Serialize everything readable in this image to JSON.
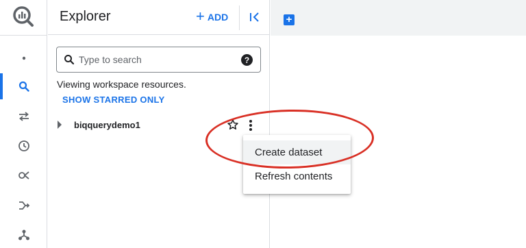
{
  "explorer": {
    "title": "Explorer",
    "add_label": "ADD",
    "search": {
      "placeholder": "Type to search",
      "value": ""
    },
    "help_glyph": "?",
    "viewing_text": "Viewing workspace resources.",
    "show_starred_label": "SHOW STARRED ONLY",
    "projects": [
      {
        "name": "biqquerydemo1"
      }
    ]
  },
  "context_menu": {
    "items": [
      {
        "label": "Create dataset"
      },
      {
        "label": "Refresh contents"
      }
    ]
  },
  "rail": {
    "items": [
      {
        "icon": "dot-icon"
      },
      {
        "icon": "search-icon",
        "active": true
      },
      {
        "icon": "transfers-icon"
      },
      {
        "icon": "history-icon"
      },
      {
        "icon": "analytics-hub-icon"
      },
      {
        "icon": "dataflow-icon"
      },
      {
        "icon": "connections-icon"
      }
    ]
  },
  "tabs": {
    "new_tab_glyph": "+"
  },
  "colors": {
    "accent": "#1a73e8",
    "annotation": "#d93025",
    "divider": "#dadce0",
    "tabbar_bg": "#f1f3f4"
  }
}
